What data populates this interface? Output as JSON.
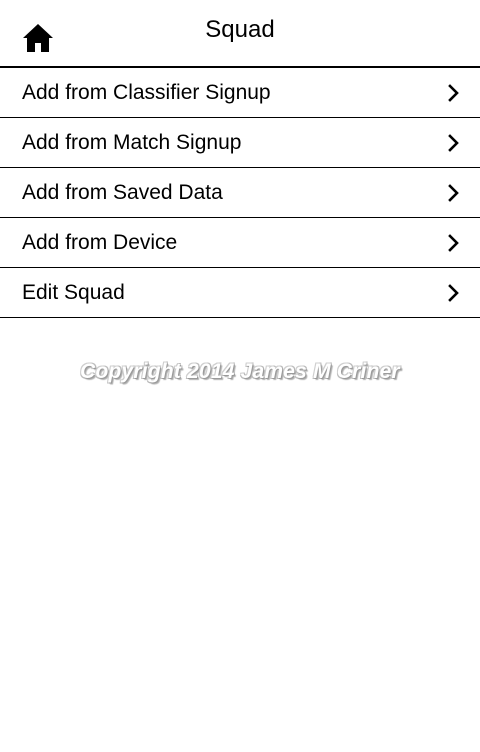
{
  "header": {
    "title": "Squad",
    "home_icon": "home-icon"
  },
  "menu": {
    "items": [
      {
        "label": "Add from Classifier Signup",
        "icon": "chevron-right-icon"
      },
      {
        "label": "Add from Match Signup",
        "icon": "chevron-right-icon"
      },
      {
        "label": "Add from Saved Data",
        "icon": "chevron-right-icon"
      },
      {
        "label": "Add from Device",
        "icon": "chevron-right-icon"
      },
      {
        "label": "Edit Squad",
        "icon": "chevron-right-icon"
      }
    ]
  },
  "footer": {
    "copyright": "Copyright 2014 James M Criner"
  },
  "colors": {
    "background": "#ffffff",
    "text": "#000000",
    "divider": "#000000"
  }
}
